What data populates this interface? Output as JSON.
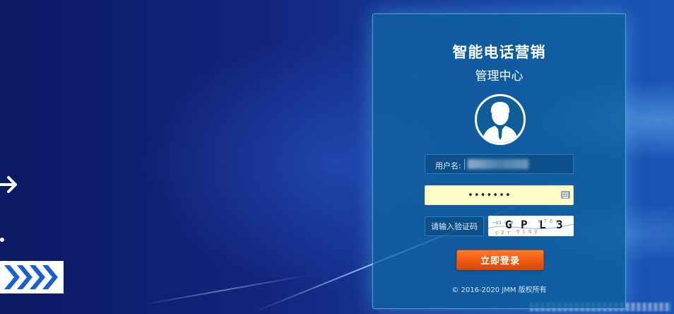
{
  "login_panel": {
    "title": "智能电话营销",
    "subtitle": "管理中心",
    "username": {
      "label": "用户名:",
      "value": "\\"
    },
    "password": {
      "value": "•••••••"
    },
    "captcha": {
      "placeholder": "请输入验证码",
      "image_text": [
        "G",
        "P",
        "L",
        "3"
      ]
    },
    "login_button": "立即登录",
    "copyright": "© 2016-2020 JMM 版权所有"
  },
  "icons": {
    "avatar": "user-avatar-icon",
    "keyboard": "keyboard-icon",
    "arrow": "arrow-right-icon",
    "chevrons": "chevrons-icon"
  },
  "colors": {
    "background": "#12257e",
    "panel": "#10649f",
    "password_field": "#fbfcc6",
    "login_button": "#f15a11"
  }
}
